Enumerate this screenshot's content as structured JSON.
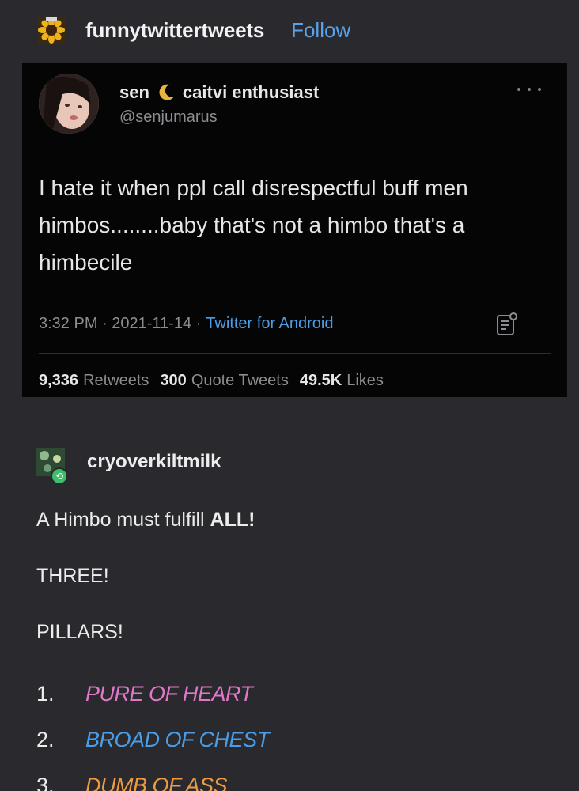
{
  "post": {
    "blog_name": "funnytwittertweets",
    "follow_label": "Follow"
  },
  "tweet": {
    "display_name": "sen",
    "display_name_suffix": "caitvi enthusiast",
    "handle": "@senjumarus",
    "text": "I hate it when ppl call disrespectful buff men himbos........baby that's not a himbo that's a himbecile",
    "time": "3:32 PM",
    "date": "2021-11-14",
    "source": "Twitter for Android",
    "retweets_count": "9,336",
    "retweets_label": "Retweets",
    "quotes_count": "300",
    "quotes_label": "Quote Tweets",
    "likes_count": "49.5K",
    "likes_label": "Likes"
  },
  "reblog": {
    "blog_name": "cryoverkiltmilk",
    "line1_prefix": "A Himbo must fulfill ",
    "line1_bold": "ALL!",
    "line2": "THREE!",
    "line3": "PILLARS!",
    "pillars": [
      {
        "num": "1.",
        "text": "PURE OF HEART",
        "color": "#e078c9"
      },
      {
        "num": "2.",
        "text": "BROAD OF CHEST",
        "color": "#4a9de6"
      },
      {
        "num": "3.",
        "text": "DUMB OF ASS",
        "color": "#ec9a44"
      }
    ]
  },
  "colors": {
    "background": "#2a2a2e",
    "tweet_background": "#050505",
    "link_blue": "#5aa1e6"
  }
}
